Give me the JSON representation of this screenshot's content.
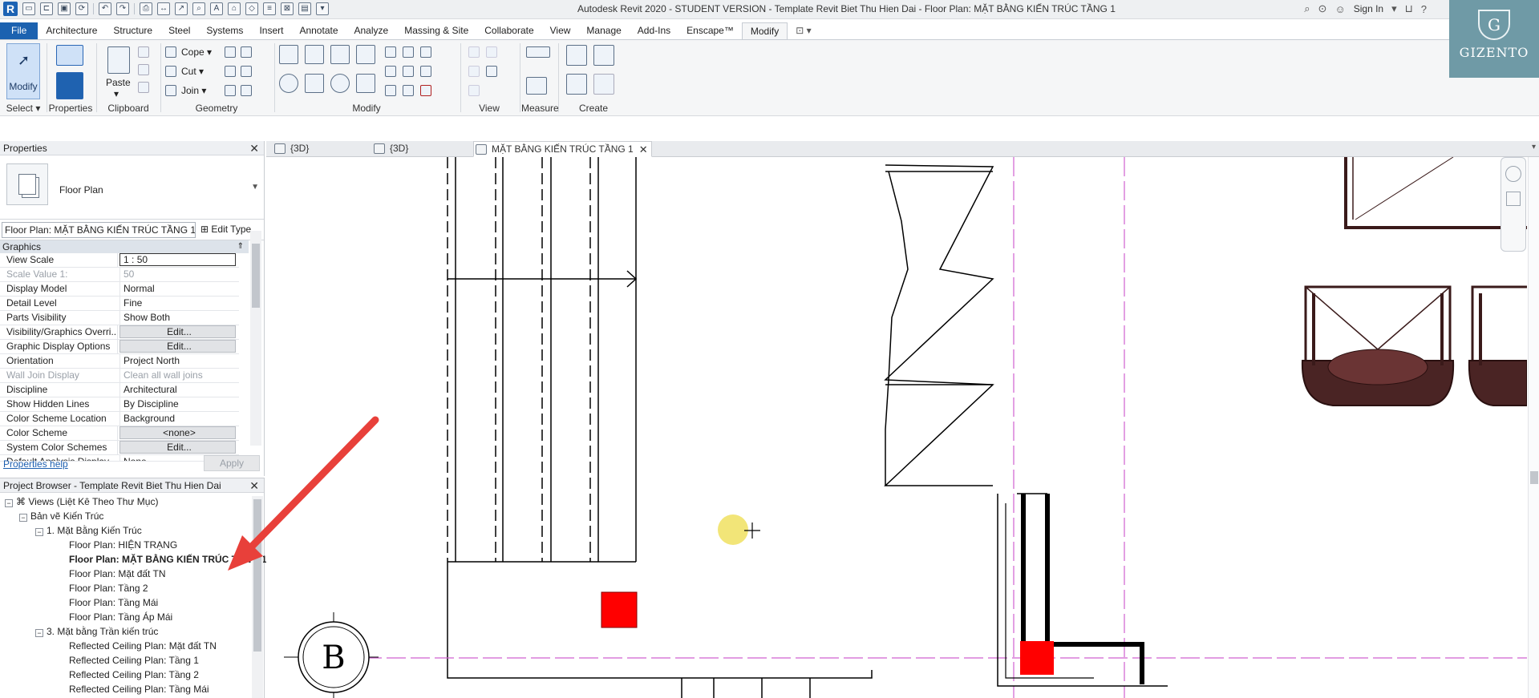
{
  "window": {
    "title": "Autodesk Revit 2020 - STUDENT VERSION - Template Revit Biet Thu Hien Dai - Floor Plan: MẶT BẰNG KIẾN TRÚC TẦNG 1",
    "sign_in": "Sign In",
    "help": "?",
    "close": "✕"
  },
  "ribbon_tabs": [
    "File",
    "Architecture",
    "Structure",
    "Steel",
    "Systems",
    "Insert",
    "Annotate",
    "Analyze",
    "Massing & Site",
    "Collaborate",
    "View",
    "Manage",
    "Add-Ins",
    "Enscape™",
    "Modify"
  ],
  "ribbon": {
    "select": {
      "button": "Modify",
      "label": "Select"
    },
    "properties": {
      "label": "Properties"
    },
    "clipboard": {
      "paste": "Paste",
      "label": "Clipboard"
    },
    "geometry": {
      "cope": "Cope",
      "cut": "Cut",
      "join": "Join",
      "label": "Geometry"
    },
    "modify": {
      "label": "Modify"
    },
    "view": {
      "label": "View"
    },
    "measure": {
      "label": "Measure"
    },
    "create": {
      "label": "Create"
    }
  },
  "brand": {
    "name": "GIZENTO",
    "letter": "G"
  },
  "properties": {
    "title": "Properties",
    "type_name": "Floor Plan",
    "instance_selector": "Floor Plan: MẶT BẰNG KIẾN TRÚC TẦNG 1",
    "edit_type": "Edit Type",
    "category": "Graphics",
    "rows": [
      {
        "name": "View Scale",
        "value": "1 : 50"
      },
      {
        "name": "Scale Value    1:",
        "value": "50"
      },
      {
        "name": "Display Model",
        "value": "Normal"
      },
      {
        "name": "Detail Level",
        "value": "Fine"
      },
      {
        "name": "Parts Visibility",
        "value": "Show Both"
      },
      {
        "name": "Visibility/Graphics Overri...",
        "value": "Edit..."
      },
      {
        "name": "Graphic Display Options",
        "value": "Edit..."
      },
      {
        "name": "Orientation",
        "value": "Project North"
      },
      {
        "name": "Wall Join Display",
        "value": "Clean all wall joins"
      },
      {
        "name": "Discipline",
        "value": "Architectural"
      },
      {
        "name": "Show Hidden Lines",
        "value": "By Discipline"
      },
      {
        "name": "Color Scheme Location",
        "value": "Background"
      },
      {
        "name": "Color Scheme",
        "value": "<none>"
      },
      {
        "name": "System Color Schemes",
        "value": "Edit..."
      },
      {
        "name": "Default Analysis Display ...",
        "value": "None"
      }
    ],
    "help_link": "Properties help",
    "apply": "Apply"
  },
  "browser": {
    "title": "Project Browser - Template Revit Biet Thu Hien Dai",
    "nodes": [
      {
        "label": "Views (Liệt Kê Theo Thư Mục)"
      },
      {
        "label": "Bản vẽ Kiến Trúc"
      },
      {
        "label": "1. Mặt Bằng Kiến Trúc"
      },
      {
        "label": "Floor Plan: HIỆN TRẠNG"
      },
      {
        "label": "Floor Plan: MẶT BẰNG KIẾN TRÚC TẦNG 1"
      },
      {
        "label": "Floor Plan: Mặt đất TN"
      },
      {
        "label": "Floor Plan: Tầng 2"
      },
      {
        "label": "Floor Plan: Tầng Mái"
      },
      {
        "label": "Floor Plan: Tầng Áp Mái"
      },
      {
        "label": "3. Mặt bằng Trần kiến trúc"
      },
      {
        "label": "Reflected Ceiling Plan: Mặt đất TN"
      },
      {
        "label": "Reflected Ceiling Plan: Tầng 1"
      },
      {
        "label": "Reflected Ceiling Plan: Tầng 2"
      },
      {
        "label": "Reflected Ceiling Plan: Tầng Mái"
      }
    ]
  },
  "view_tabs": [
    {
      "label": "{3D}"
    },
    {
      "label": "{3D}"
    },
    {
      "label": "MẶT BẰNG KIẾN TRÚC TẦNG 1"
    }
  ],
  "drawing": {
    "grid_bubble": "B",
    "colors": {
      "line": "#000000",
      "grid": "#d060d0",
      "highlight": "#ff0000",
      "furniture": "#3a1a1a",
      "cursor_dot": "#f0e060",
      "annotation_arrow": "#e8403a"
    }
  }
}
